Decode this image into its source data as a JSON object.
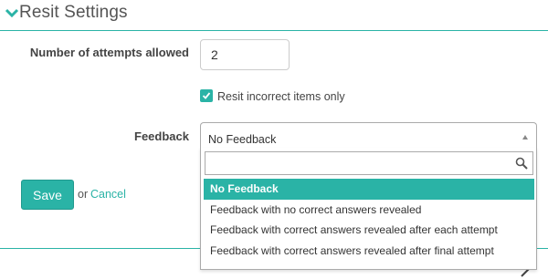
{
  "section": {
    "title": "Resit Settings",
    "collapse_icon": "chevron-down-icon"
  },
  "form": {
    "attempts_label": "Number of attempts allowed",
    "attempts_value": "2",
    "resit_checkbox_label": "Resit incorrect items only",
    "resit_checkbox_checked": true,
    "feedback_label": "Feedback",
    "feedback_selected": "No Feedback"
  },
  "dropdown": {
    "search_placeholder": "",
    "search_icon": "search-icon",
    "options": [
      "No Feedback",
      "Feedback with no correct answers revealed",
      "Feedback with correct answers revealed after each attempt",
      "Feedback with correct answers revealed after final attempt"
    ],
    "selected_index": 0
  },
  "actions": {
    "save_label": "Save",
    "or_text": "or",
    "cancel_label": "Cancel"
  },
  "colors": {
    "accent": "#2ab3a6",
    "text": "#333333",
    "border": "#aaaaaa"
  }
}
